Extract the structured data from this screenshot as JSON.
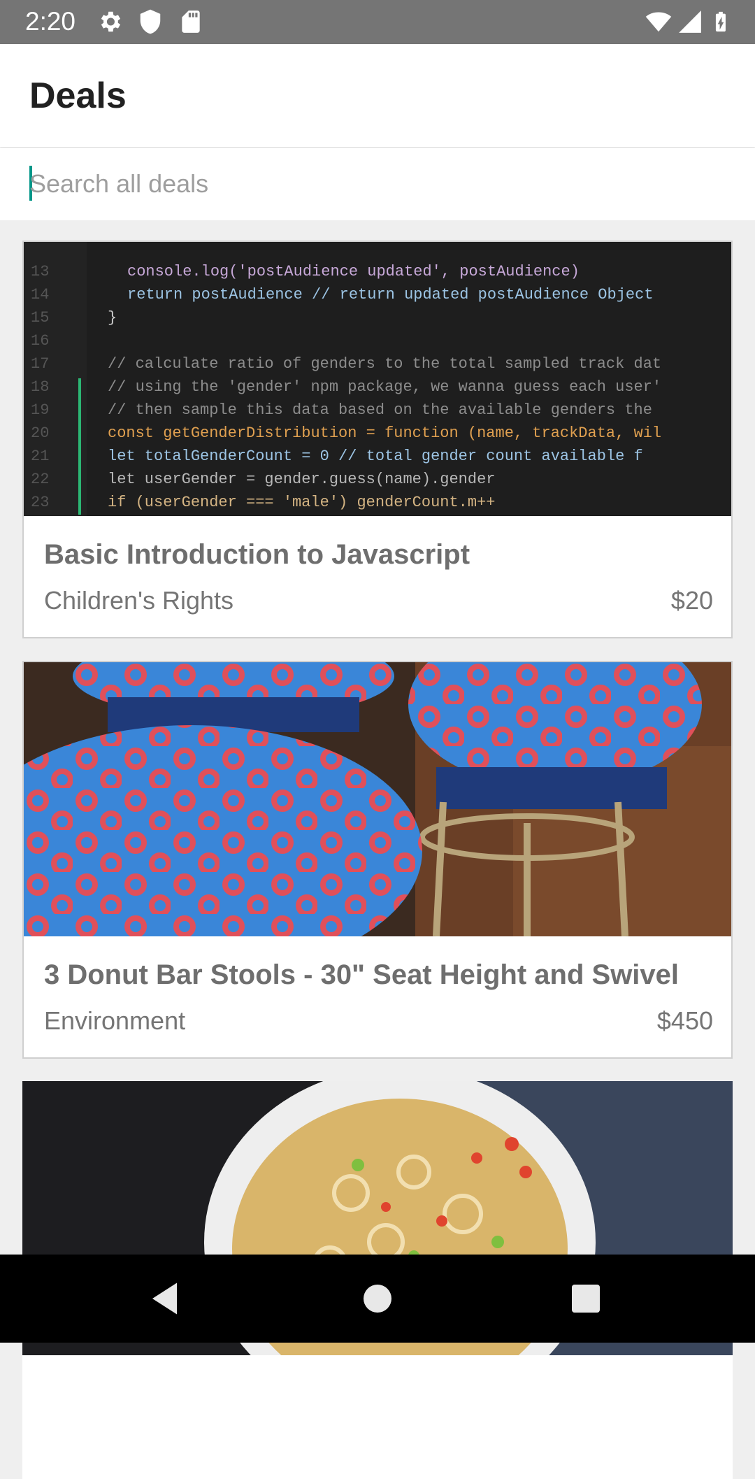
{
  "status_bar": {
    "time": "2:20",
    "left_icons": [
      "gear-icon",
      "shield-icon",
      "sd-card-icon"
    ],
    "right_icons": [
      "wifi-icon",
      "cell-signal-icon",
      "battery-icon"
    ]
  },
  "header": {
    "title": "Deals"
  },
  "search": {
    "placeholder": "Search all deals",
    "value": ""
  },
  "deals": [
    {
      "title": "Basic Introduction to Javascript",
      "category": "Children's Rights",
      "price": "$20",
      "image": "code-editor-screenshot"
    },
    {
      "title": "3 Donut Bar Stools - 30\" Seat Height and Swivel",
      "category": "Environment",
      "price": "$450",
      "image": "donut-bar-stools-photo"
    },
    {
      "title": "",
      "category": "",
      "price": "",
      "image": "noodle-soup-bowl-photo"
    }
  ],
  "code_snippet": [
    "console.log('postAudience updated', postAudience)",
    "return postAudience // return updated postAudience Object",
    "}",
    "",
    "// calculate ratio of genders to the total sampled track dat",
    "// using the 'gender' npm package, we wanna guess each user'",
    "// then sample this data based on the available genders the",
    "const getGenderDistribution = function (name, trackData, wil",
    "  let totalGenderCount = 0 // total gender count available f",
    "  let userGender = gender.guess(name).gender",
    "  if (userGender === 'male') genderCount.m++"
  ],
  "navigation": {
    "buttons": [
      "back-icon",
      "home-icon",
      "recents-icon"
    ]
  },
  "colors": {
    "accent": "#009688",
    "status_bar": "#757575",
    "nav_bar": "#000000"
  }
}
